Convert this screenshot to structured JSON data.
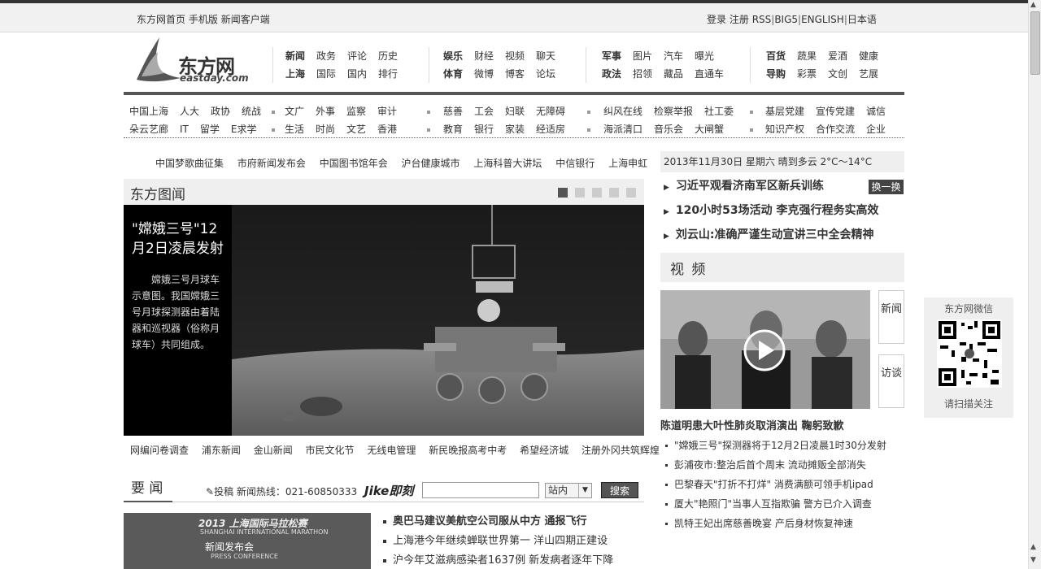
{
  "topbar": {
    "left_links": [
      "东方网首页",
      "手机版",
      "新闻客户端"
    ],
    "right_links": [
      "登录",
      "注册",
      "RSS",
      "BIG5",
      "ENGLISH",
      "日本语"
    ]
  },
  "logo": {
    "brand": "东方网",
    "domain": "eastday.com"
  },
  "main_nav": [
    {
      "row1": [
        "新闻",
        "政务",
        "评论",
        "历史"
      ],
      "row2": [
        "上海",
        "国际",
        "国内",
        "排行"
      ]
    },
    {
      "row1": [
        "娱乐",
        "财经",
        "视频",
        "聊天"
      ],
      "row2": [
        "体育",
        "微博",
        "博客",
        "论坛"
      ]
    },
    {
      "row1": [
        "军事",
        "图片",
        "汽车",
        "曝光"
      ],
      "row2": [
        "政法",
        "招领",
        "藏品",
        "直通车"
      ]
    },
    {
      "row1": [
        "百货",
        "蔬果",
        "爱酒",
        "健康"
      ],
      "row2": [
        "导购",
        "彩票",
        "文创",
        "艺展"
      ]
    }
  ],
  "sub_nav": [
    {
      "row1": [
        "中国上海",
        "人大",
        "政协",
        "统战"
      ],
      "row2": [
        "朵云艺廊",
        "IT",
        "留学",
        "E求学"
      ]
    },
    {
      "row1": [
        "文广",
        "外事",
        "监察",
        "审计"
      ],
      "row2": [
        "生活",
        "时尚",
        "文艺",
        "香港"
      ]
    },
    {
      "row1": [
        "慈善",
        "工会",
        "妇联",
        "无障碍"
      ],
      "row2": [
        "教育",
        "银行",
        "家装",
        "经适房"
      ]
    },
    {
      "row1": [
        "纠风在线",
        "检察举报",
        "社工委"
      ],
      "row2": [
        "海派清口",
        "音乐会",
        "大闸蟹"
      ]
    },
    {
      "row1": [
        "基层党建",
        "宣传党建",
        "诚信"
      ],
      "row2": [
        "知识产权",
        "合作交流",
        "企业"
      ]
    }
  ],
  "hot_links": [
    "中国梦歌曲征集",
    "市府新闻发布会",
    "中国图书馆年会",
    "沪台健康城市",
    "上海科普大讲坛",
    "中信银行",
    "上海申虹"
  ],
  "photo_news": {
    "section_title": "东方图闻",
    "headline": "\"嫦娥三号\"12月2日凌晨发射",
    "description": "嫦娥三号月球车示意图。我国嫦娥三号月球探测器由着陆器和巡视器（俗称月球车）共同组成。",
    "pages": 5,
    "active_page": 1
  },
  "photo_links": [
    "网编问卷调查",
    "浦东新闻",
    "金山新闻",
    "市民文化节",
    "无线电管理",
    "新民晚报高考中考",
    "希望经济城",
    "注册外冈共筑辉煌"
  ],
  "important_news": {
    "section_title": "要 闻",
    "submit_text": "投稿 新闻热线：021-60850333",
    "jike_logo": "Jike即刻",
    "search_placeholder": "",
    "search_scope": "站内",
    "search_button": "搜索",
    "photo_text": {
      "line1": "2013 上海国际马拉松赛",
      "line2": "SHANGHAI INTERNATIONAL MARATHON",
      "line3": "新闻发布会",
      "line4": "PRESS CONFERENCE"
    },
    "items": [
      {
        "text": "奥巴马建议美航空公司服从中方 通报飞行",
        "bold": true
      },
      {
        "text": "上海港今年继续蝉联世界第一 洋山四期正建设",
        "bold": false
      },
      {
        "text": "沪今年艾滋病感染者1637例 新发病者逐年下降",
        "bold": false
      }
    ]
  },
  "right_column": {
    "date_weather": "2013年11月30日 星期六 晴到多云 2°C～14°C",
    "headlines": [
      "习近平观看济南军区新兵训练",
      "120小时53场活动 李克强行程务实高效",
      "刘云山:准确严谨生动宣讲三中全会精神"
    ],
    "swap_button": "换一换",
    "video_title": "视 频",
    "video_tabs": [
      "新闻",
      "访谈"
    ],
    "video_headline": "陈道明患大叶性肺炎取消演出 鞠躬致歉",
    "video_list": [
      "\"嫦娥三号\"探测器将于12月2日凌晨1时30分发射",
      "彭浦夜市:整治后首个周末 流动摊贩全部消失",
      "巴黎春天\"打折不打烊\" 消费满额可领手机ipad",
      "厦大\"艳照门\"当事人互指欺骗 警方已介入调查",
      "凯特王妃出席慈善晚宴 产后身材恢复神速"
    ]
  },
  "wechat": {
    "title": "东方网微信",
    "caption": "请扫描关注"
  }
}
